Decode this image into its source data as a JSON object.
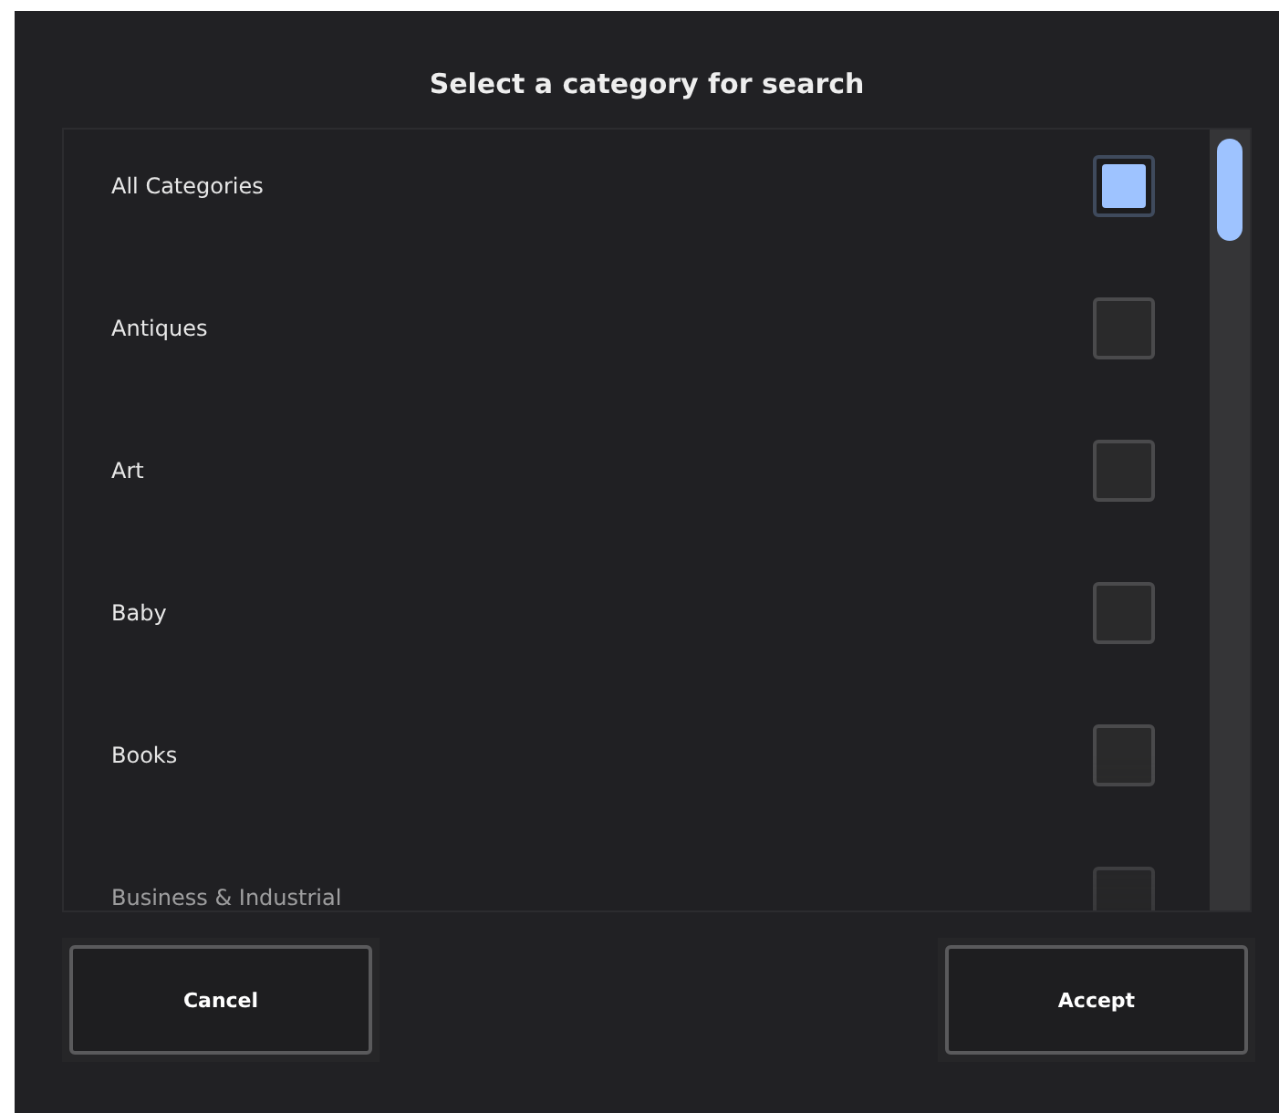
{
  "dialog": {
    "title": "Select a category for search"
  },
  "categories": [
    {
      "label": "All Categories",
      "checked": true
    },
    {
      "label": "Antiques",
      "checked": false
    },
    {
      "label": "Art",
      "checked": false
    },
    {
      "label": "Baby",
      "checked": false
    },
    {
      "label": "Books",
      "checked": false
    },
    {
      "label": "Business & Industrial",
      "checked": false
    }
  ],
  "buttons": [
    {
      "label": "Cancel"
    },
    {
      "label": "Accept"
    }
  ]
}
